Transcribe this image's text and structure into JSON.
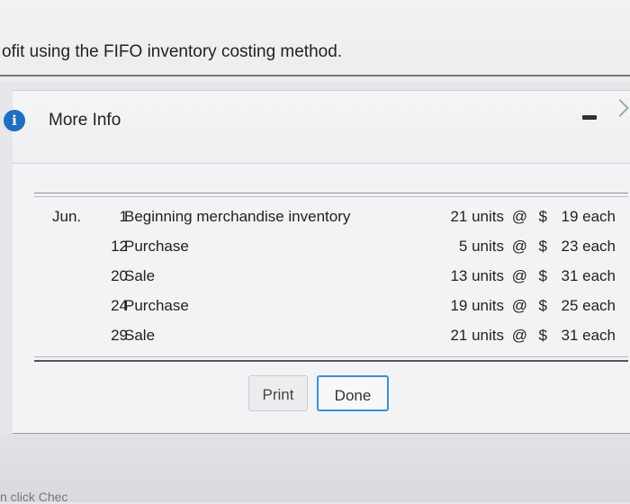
{
  "page": {
    "heading": "ofit using the FIFO inventory costing method.",
    "bottom_partial_text": "n click Chec"
  },
  "dialog": {
    "title": "More Info",
    "icon": "info-icon",
    "table": {
      "rows": [
        {
          "month": "Jun.",
          "day": "1",
          "description": "Beginning merchandise inventory",
          "units": "21 units",
          "at": "@",
          "dollar": "$",
          "cost": "19 each"
        },
        {
          "month": "",
          "day": "12",
          "description": "Purchase",
          "units": "5 units",
          "at": "@",
          "dollar": "$",
          "cost": "23 each"
        },
        {
          "month": "",
          "day": "20",
          "description": "Sale",
          "units": "13 units",
          "at": "@",
          "dollar": "$",
          "cost": "31 each"
        },
        {
          "month": "",
          "day": "24",
          "description": "Purchase",
          "units": "19 units",
          "at": "@",
          "dollar": "$",
          "cost": "25 each"
        },
        {
          "month": "",
          "day": "29",
          "description": "Sale",
          "units": "21 units",
          "at": "@",
          "dollar": "$",
          "cost": "31 each"
        }
      ]
    },
    "buttons": {
      "print_label": "Print",
      "done_label": "Done"
    }
  },
  "colors": {
    "info_icon": "#1f6fbf",
    "done_border": "#3b8fd6"
  }
}
